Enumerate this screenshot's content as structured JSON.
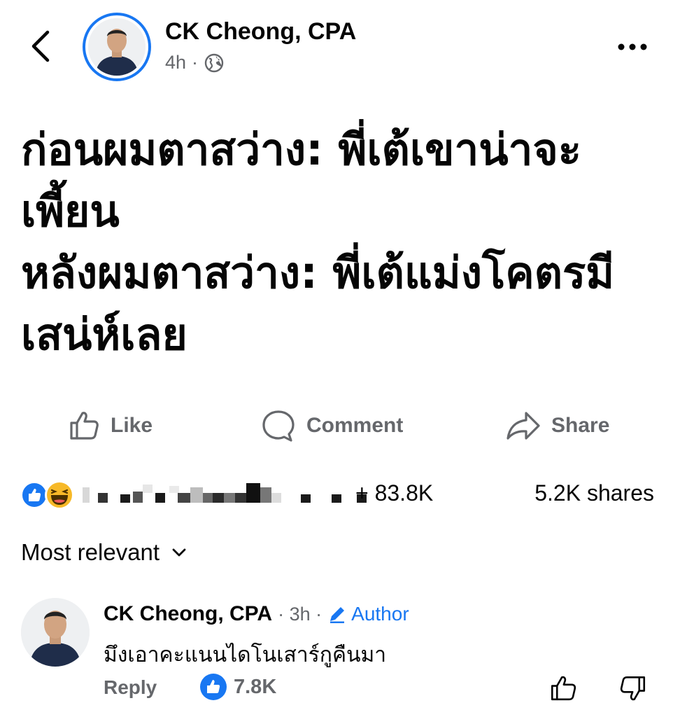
{
  "post": {
    "author": "CK Cheong, CPA",
    "time": "4h",
    "privacy_icon": "globe-icon",
    "text_lines": [
      "ก่อนผมตาสว่าง: พี่เต้เขาน่าจะ",
      "เพี้ยน",
      "หลังผมตาสว่าง: พี่เต้แม่งโคตรมี",
      "เสน่ห์เลย"
    ]
  },
  "actions": {
    "like": "Like",
    "comment": "Comment",
    "share": "Share"
  },
  "reactions": {
    "count_text": "+ 83.8K",
    "shares_text": "5.2K shares",
    "icons": [
      "like-reaction-icon",
      "haha-reaction-icon"
    ]
  },
  "comments": {
    "sort_label": "Most relevant",
    "items": [
      {
        "author": "CK Cheong, CPA",
        "time": "· 3h ·",
        "badge": "Author",
        "text": "มึงเอาคะแนนไดโนเสาร์กูคืนมา",
        "reply_label": "Reply",
        "like_count": "7.8K"
      }
    ]
  },
  "colors": {
    "accent": "#1877f2",
    "secondary_text": "#65676b",
    "primary_text": "#050505"
  }
}
